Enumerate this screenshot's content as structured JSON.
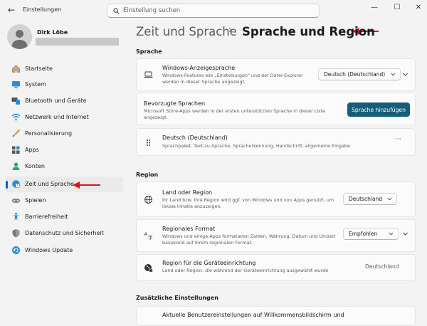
{
  "app": {
    "title": "Einstellungen",
    "search_placeholder": "Einstellung suchen",
    "controls": {
      "minimize": "—",
      "maximize": "☐",
      "close": "✕"
    }
  },
  "profile": {
    "name": "Dirk Löbe"
  },
  "sidebar": {
    "items": [
      {
        "label": "Startseite",
        "icon": "home-icon"
      },
      {
        "label": "System",
        "icon": "monitor-icon"
      },
      {
        "label": "Bluetooth und Geräte",
        "icon": "bluetooth-icon"
      },
      {
        "label": "Netzwerk und Internet",
        "icon": "wifi-icon"
      },
      {
        "label": "Personalisierung",
        "icon": "brush-icon"
      },
      {
        "label": "Apps",
        "icon": "apps-icon"
      },
      {
        "label": "Konten",
        "icon": "account-icon"
      },
      {
        "label": "Zeit und Sprache",
        "icon": "globe-clock-icon",
        "selected": true
      },
      {
        "label": "Spielen",
        "icon": "gamepad-icon"
      },
      {
        "label": "Barrierefreiheit",
        "icon": "accessibility-icon"
      },
      {
        "label": "Datenschutz und Sicherheit",
        "icon": "shield-icon"
      },
      {
        "label": "Windows Update",
        "icon": "update-icon"
      }
    ]
  },
  "header": {
    "parent": "Zeit und Sprache",
    "separator": "›",
    "title": "Sprache und Region"
  },
  "sections": {
    "language": {
      "title": "Sprache",
      "display_language": {
        "title": "Windows-Anzeigesprache",
        "desc": "Windows-Features wie „Einstellungen\" und der Datei-Explorer werden in dieser Sprache angezeigt.",
        "value": "Deutsch (Deutschland)"
      },
      "preferred": {
        "title": "Bevorzugte Sprachen",
        "desc": "Microsoft Store-Apps werden in der ersten unterstützten Sprache in dieser Liste angezeigt.",
        "button": "Sprache hinzufügen"
      },
      "german": {
        "title": "Deutsch (Deutschland)",
        "desc": "Sprachpaket, Text-zu-Sprache, Spracherkennung, Handschrift, allgemeine Eingabe",
        "more": "···"
      }
    },
    "region": {
      "title": "Region",
      "country": {
        "title": "Land oder Region",
        "desc": "Ihr Land bzw. Ihre Region wird ggf. von Windows und von Apps genutzt, um lokale Inhalte anzuzeigen.",
        "value": "Deutschland"
      },
      "format": {
        "title": "Regionales Format",
        "desc": "Windows und einige Apps formatieren Zahlen, Währung, Datum und Uhrzeit basierend auf Ihrem regionalen Format.",
        "value": "Empfohlen"
      },
      "device": {
        "title": "Region für die Geräteeinrichtung",
        "desc": "Land oder Region, die während der Geräteeinrichtung ausgewählt wurde",
        "value": "Deutschland"
      }
    },
    "additional": {
      "title": "Zusätzliche Einstellungen",
      "welcome": {
        "title": "Aktuelle Benutzereinstellungen auf Willkommensbildschirm und"
      }
    }
  },
  "colors": {
    "accent": "#0067c0",
    "button": "#145e7a",
    "annotation_arrow": "#d9151b"
  }
}
